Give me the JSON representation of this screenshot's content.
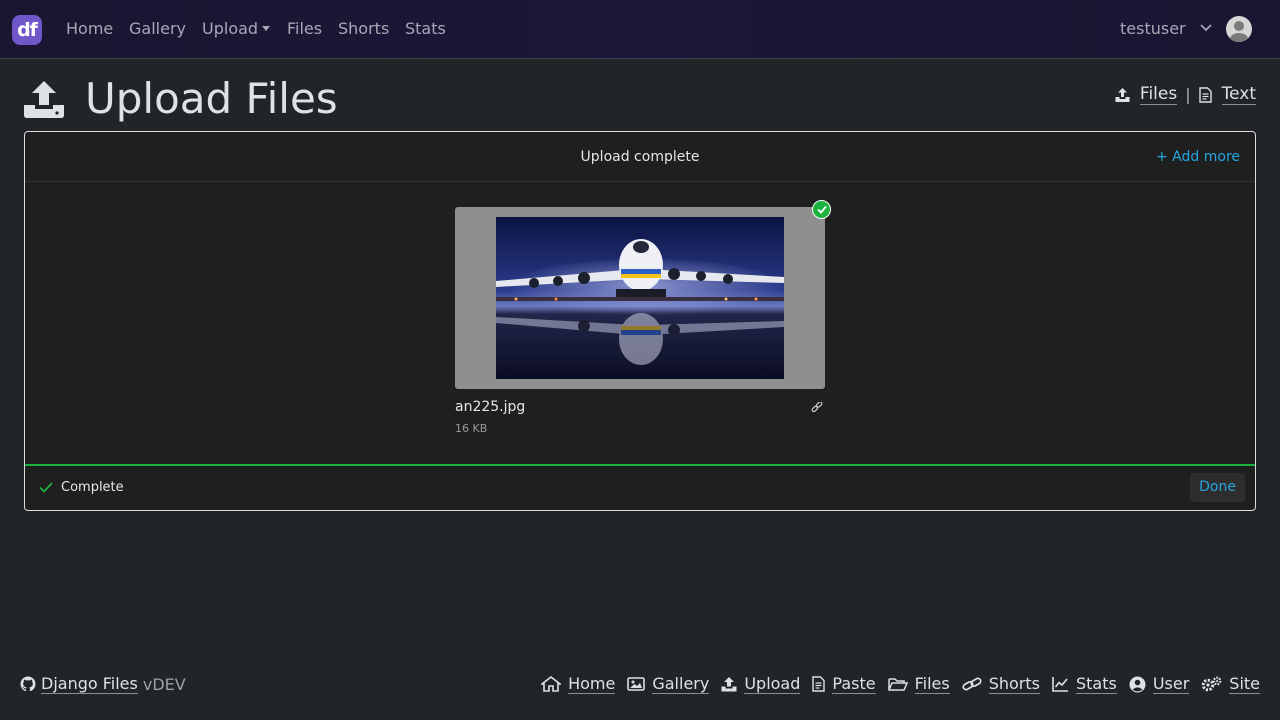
{
  "nav": {
    "brand": "df",
    "links": [
      "Home",
      "Gallery",
      "Upload",
      "Files",
      "Shorts",
      "Stats"
    ],
    "username": "testuser"
  },
  "page": {
    "title": "Upload Files",
    "mode_files": "Files",
    "mode_separator": "|",
    "mode_text": "Text"
  },
  "uploader": {
    "status": "Upload complete",
    "add_more": "+ Add more",
    "file": {
      "name": "an225.jpg",
      "size": "16 KB"
    },
    "footer_status": "Complete",
    "done": "Done"
  },
  "footer": {
    "project": "Django Files",
    "version": "vDEV",
    "links": [
      "Home",
      "Gallery",
      "Upload",
      "Paste",
      "Files",
      "Shorts",
      "Stats",
      "User",
      "Site"
    ]
  },
  "colors": {
    "accent": "#25a6e0",
    "success": "#1bb240",
    "brand": "#6f57c9"
  },
  "icons": {
    "brand": "logo-icon",
    "page": "upload-icon",
    "check": "check-icon",
    "link": "link-icon",
    "github": "github-icon"
  }
}
